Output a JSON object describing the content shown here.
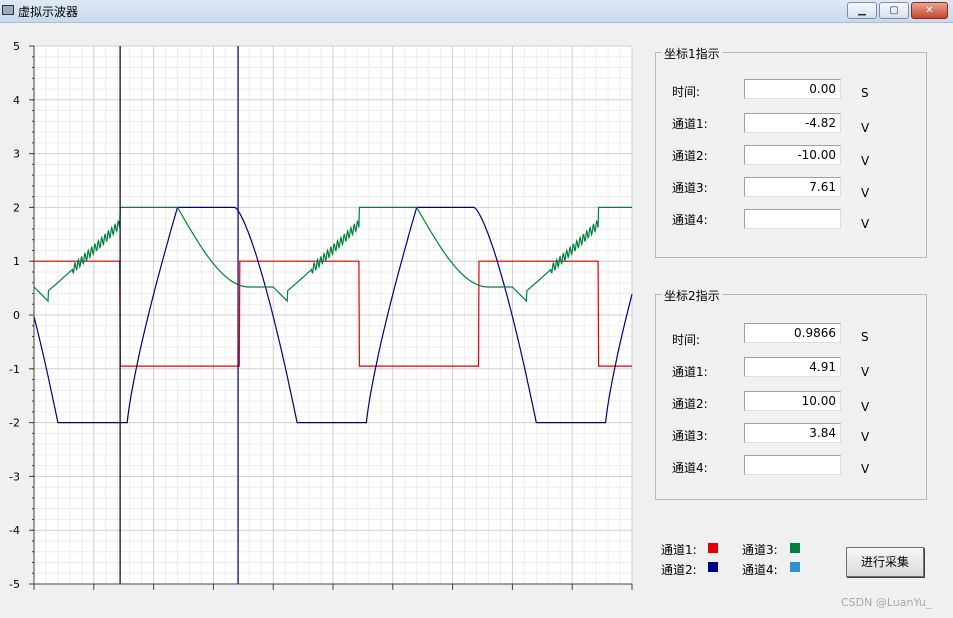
{
  "window": {
    "title": "虚拟示波器",
    "controls": {
      "minimize": "▁",
      "maximize": "▢",
      "close": "✕"
    }
  },
  "chart_data": {
    "type": "line",
    "xlim": [
      0,
      1.25
    ],
    "ylim": [
      -5,
      5
    ],
    "yticks": [
      5,
      4,
      3,
      2,
      1,
      0,
      -1,
      -2,
      -3,
      -4,
      -5
    ],
    "grid": true,
    "cursors": [
      {
        "name": "坐标1",
        "x": 0.18,
        "color": "#000000"
      },
      {
        "name": "坐标2",
        "x": 0.4266,
        "color": "#000080"
      }
    ],
    "series": [
      {
        "channel": "通道1",
        "color": "#e00000",
        "style": "square"
      },
      {
        "channel": "通道2",
        "color": "#000080",
        "style": "trapezoid"
      },
      {
        "channel": "通道3",
        "color": "#008040",
        "style": "triangle"
      }
    ]
  },
  "cursor1": {
    "title": "坐标1指示",
    "rows": [
      {
        "label": "时间:",
        "value": "0.00",
        "unit": "S"
      },
      {
        "label": "通道1:",
        "value": "-4.82",
        "unit": "V"
      },
      {
        "label": "通道2:",
        "value": "-10.00",
        "unit": "V"
      },
      {
        "label": "通道3:",
        "value": "7.61",
        "unit": "V"
      },
      {
        "label": "通道4:",
        "value": "",
        "unit": "V"
      }
    ]
  },
  "cursor2": {
    "title": "坐标2指示",
    "rows": [
      {
        "label": "时间:",
        "value": "0.9866",
        "unit": "S"
      },
      {
        "label": "通道1:",
        "value": "4.91",
        "unit": "V"
      },
      {
        "label": "通道2:",
        "value": "10.00",
        "unit": "V"
      },
      {
        "label": "通道3:",
        "value": "3.84",
        "unit": "V"
      },
      {
        "label": "通道4:",
        "value": "",
        "unit": "V"
      }
    ]
  },
  "legend": [
    {
      "label": "通道1:",
      "color": "#e00000"
    },
    {
      "label": "通道2:",
      "color": "#00008b"
    },
    {
      "label": "通道3:",
      "color": "#008040"
    },
    {
      "label": "通道4:",
      "color": "#3090d0"
    }
  ],
  "acquire_button": "进行采集",
  "watermark": "CSDN @LuanYu_"
}
